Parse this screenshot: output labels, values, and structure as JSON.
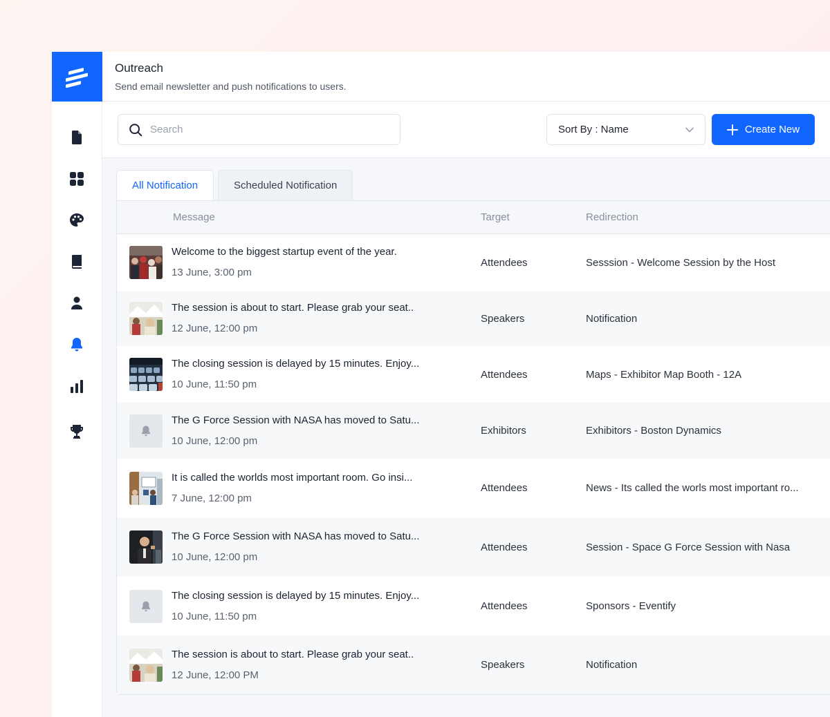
{
  "app": {
    "title": "Outreach",
    "subtitle": "Send email newsletter and push notifications to users."
  },
  "colors": {
    "accent": "#1166ff",
    "sidebar_icon": "#1c2436"
  },
  "sidebar": {
    "items": [
      {
        "icon": "document-icon",
        "active": false
      },
      {
        "icon": "grid-icon",
        "active": false
      },
      {
        "icon": "palette-icon",
        "active": false
      },
      {
        "icon": "book-icon",
        "active": false
      },
      {
        "icon": "user-icon",
        "active": false
      },
      {
        "icon": "bell-icon",
        "active": true
      },
      {
        "icon": "bar-chart-icon",
        "active": false
      },
      {
        "icon": "trophy-icon",
        "active": false
      }
    ]
  },
  "toolbar": {
    "search_placeholder": "Search",
    "sort_label": "Sort By : Name",
    "create_label": "Create New"
  },
  "tabs": [
    {
      "label": "All Notification",
      "active": true
    },
    {
      "label": "Scheduled Notification",
      "active": false
    }
  ],
  "table": {
    "headers": {
      "message": "Message",
      "target": "Target",
      "redirection": "Redirection"
    },
    "rows": [
      {
        "thumb": "crowd-photo",
        "title": "Welcome to the biggest startup event of the year.",
        "date": "13 June, 3:00 pm",
        "target": "Attendees",
        "redirection": "Sesssion - Welcome Session by the Host"
      },
      {
        "thumb": "tent-photo",
        "title": "The session is about to start. Please grab your seat..",
        "date": "12 June, 12:00 pm",
        "target": "Speakers",
        "redirection": "Notification"
      },
      {
        "thumb": "seats-photo",
        "title": "The closing session is delayed by 15 minutes. Enjoy...",
        "date": "10 June, 11:50 pm",
        "target": "Attendees",
        "redirection": "Maps - Exhibitor Map Booth - 12A"
      },
      {
        "thumb": "bell",
        "title": "The G Force Session with NASA has moved to Satu...",
        "date": "10 June, 12:00 pm",
        "target": "Exhibitors",
        "redirection": "Exhibitors - Boston Dynamics"
      },
      {
        "thumb": "room-photo",
        "title": "It is  called the worlds most important room. Go insi...",
        "date": "7 June, 12:00 pm",
        "target": "Attendees",
        "redirection": "News - Its called the worls most important ro..."
      },
      {
        "thumb": "speaker-photo",
        "title": "The G Force Session with NASA has moved to Satu...",
        "date": "10 June, 12:00 pm",
        "target": "Attendees",
        "redirection": "Session - Space G Force Session with Nasa"
      },
      {
        "thumb": "bell",
        "title": "The closing session is delayed by 15 minutes. Enjoy...",
        "date": "10 June, 11:50 pm",
        "target": "Attendees",
        "redirection": "Sponsors - Eventify"
      },
      {
        "thumb": "tent-photo",
        "title": "The session is about to start. Please grab your seat..",
        "date": "12 June, 12:00 PM",
        "target": "Speakers",
        "redirection": "Notification"
      }
    ]
  }
}
